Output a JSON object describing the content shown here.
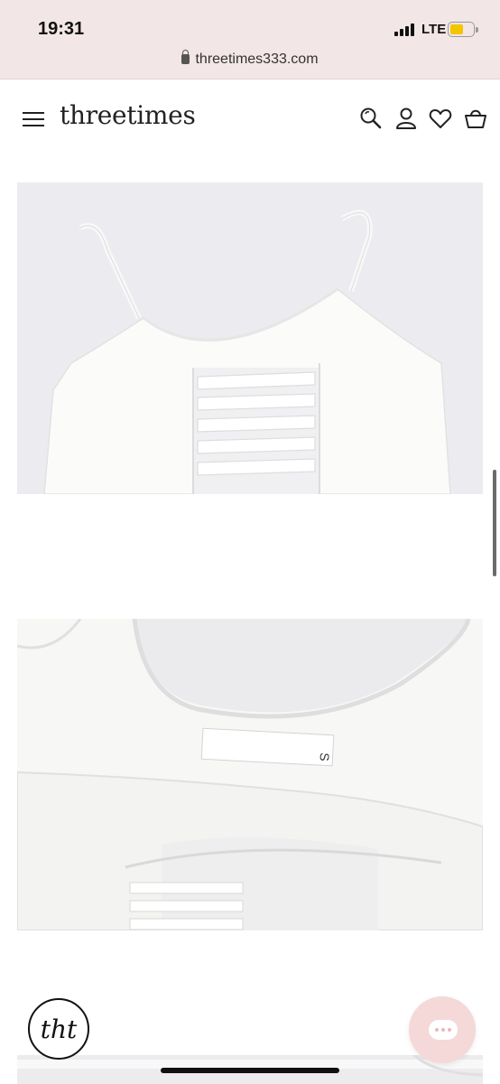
{
  "status_bar": {
    "time": "19:31",
    "network": "LTE",
    "battery_level": 0.6
  },
  "browser": {
    "url": "threetimes333.com",
    "lock_icon": "lock-icon"
  },
  "header": {
    "logo": "threetimes",
    "icons": [
      "menu-icon",
      "search-icon",
      "account-icon",
      "heart-icon",
      "cart-icon"
    ]
  },
  "product_images": [
    {
      "description_label": "white camisole front with lace-up cutout",
      "tag_text": ""
    },
    {
      "description_label": "white camisole inner back",
      "tag_text": "S"
    },
    {
      "description_label": "white camisole detail"
    }
  ],
  "floating": {
    "brand_badge": "tht",
    "chat_icon": "chat-icon"
  },
  "colors": {
    "status_bg": "#f3e6e6",
    "chat_bg": "#f4d9d8",
    "battery": "#f2c500"
  }
}
